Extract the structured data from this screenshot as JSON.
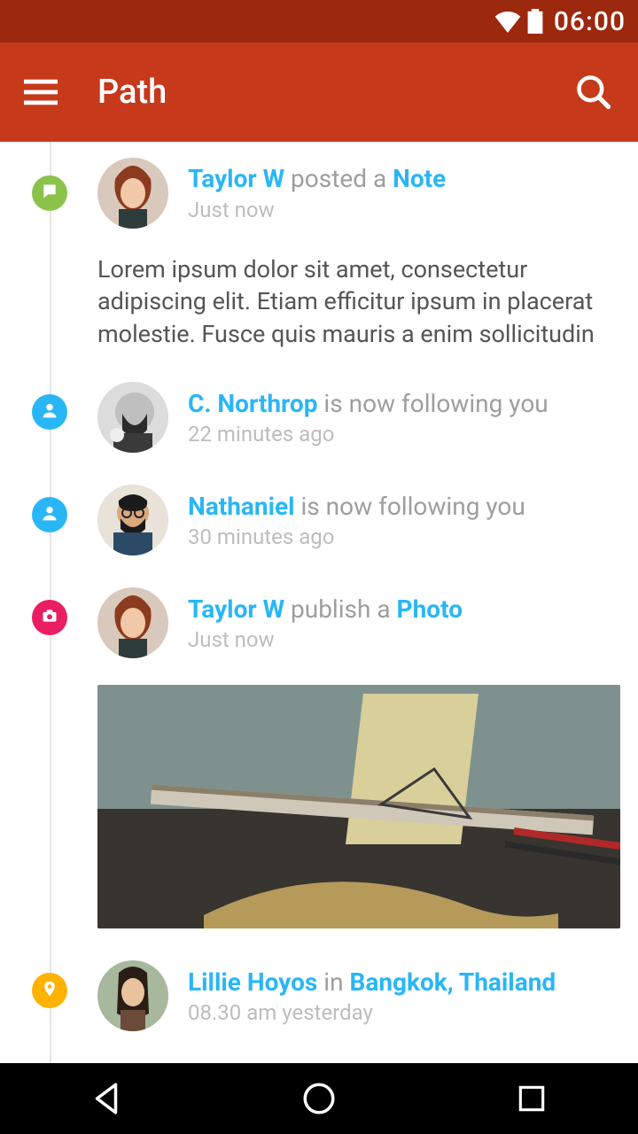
{
  "status": {
    "time": "06:00"
  },
  "appbar": {
    "title": "Path"
  },
  "feed": [
    {
      "badge": "note",
      "avatar": "redhead-woman",
      "title_parts": [
        {
          "text": "Taylor W",
          "link": true
        },
        {
          "text": " posted a ",
          "link": false
        },
        {
          "text": "Note",
          "link": true
        }
      ],
      "timestamp": "Just now",
      "body": "Lorem ipsum dolor sit amet, consectetur adipiscing elit. Etiam efficitur ipsum in placerat molestie.  Fusce quis mauris a enim sollicitudin"
    },
    {
      "badge": "person",
      "avatar": "bw-beard-man",
      "title_parts": [
        {
          "text": "C. Northrop",
          "link": true
        },
        {
          "text": " is now following you",
          "link": false
        }
      ],
      "timestamp": "22 minutes ago"
    },
    {
      "badge": "person",
      "avatar": "glasses-beard-man",
      "title_parts": [
        {
          "text": "Nathaniel",
          "link": true
        },
        {
          "text": " is now following you",
          "link": false
        }
      ],
      "timestamp": "30 minutes ago"
    },
    {
      "badge": "photo",
      "avatar": "redhead-woman",
      "title_parts": [
        {
          "text": "Taylor W",
          "link": true
        },
        {
          "text": " publish a ",
          "link": false
        },
        {
          "text": "Photo",
          "link": true
        }
      ],
      "timestamp": "Just now",
      "photo": true
    },
    {
      "badge": "location",
      "avatar": "asian-woman",
      "title_parts": [
        {
          "text": "Lillie Hoyos",
          "link": true
        },
        {
          "text": " in ",
          "link": false
        },
        {
          "text": "Bangkok, Thailand",
          "link": true
        }
      ],
      "timestamp": "08.30 am yesterday"
    }
  ],
  "colors": {
    "link": "#29B6F6",
    "appbar": "#C6391A",
    "statusbar": "#9C280E"
  }
}
